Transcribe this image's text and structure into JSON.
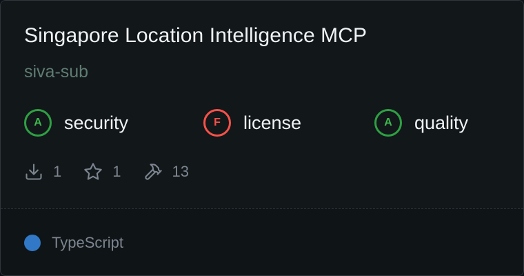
{
  "card": {
    "title": "Singapore Location Intelligence MCP",
    "owner": "siva-sub"
  },
  "scores": [
    {
      "grade": "A",
      "label": "security",
      "status_color": "#2ea043"
    },
    {
      "grade": "F",
      "label": "license",
      "status_color": "#f85149"
    },
    {
      "grade": "A",
      "label": "quality",
      "status_color": "#2ea043"
    }
  ],
  "stats": {
    "downloads": {
      "icon": "download-icon",
      "value": "1"
    },
    "stars": {
      "icon": "star-icon",
      "value": "1"
    },
    "tools": {
      "icon": "hammer-icon",
      "value": "13"
    }
  },
  "language": {
    "name": "TypeScript",
    "color": "#3178c6"
  }
}
